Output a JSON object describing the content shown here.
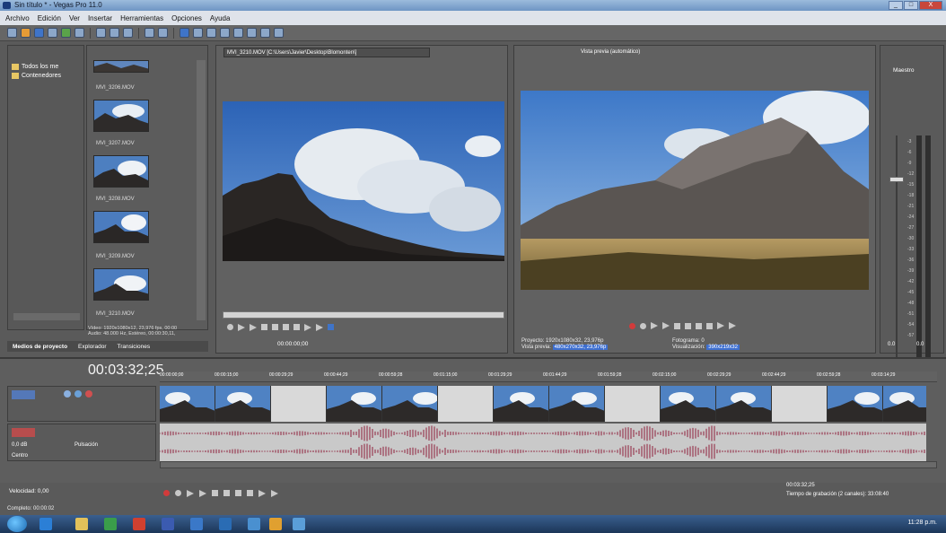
{
  "window": {
    "title": "Sin título * - Vegas Pro 11.0",
    "controls": [
      "_",
      "□",
      "X"
    ]
  },
  "menu": {
    "items": [
      "Archivo",
      "Edición",
      "Ver",
      "Insertar",
      "Herramientas",
      "Opciones",
      "Ayuda"
    ]
  },
  "media_panel": {
    "tree_items": [
      "Todos los me",
      "Contenedores"
    ],
    "thumbnails": [
      "MVI_3206.MOV",
      "MVI_3207.MOV",
      "MVI_3208.MOV",
      "MVI_3209.MOV",
      "MVI_3210.MOV"
    ],
    "info_lines": [
      "Vídeo: 1920x1080x12, 23,976 fps, 00:00",
      "Audio: 48.000 Hz, Estéreo, 00:00:30,11,"
    ],
    "tabs": [
      "Medios de proyecto",
      "Explorador",
      "Transiciones"
    ]
  },
  "trimmer": {
    "path": "MVI_3210.MOV   [C:\\Users\\Javier\\Desktop\\Blomonten\\]",
    "timecode": "00:00:00;00"
  },
  "preview": {
    "quality": "Vista previa (automático)",
    "info": {
      "project_label": "Proyecto:",
      "project_value": "1920x1080x32, 23,976p",
      "preview_label": "Vista previa:",
      "preview_value": "480x270x32, 23,976p",
      "frame_label": "Fotograma:",
      "frame_value": "0",
      "display_label": "Visualización:",
      "display_value": "390x219x32"
    }
  },
  "master": {
    "label": "Maestro",
    "db_ticks": [
      "-3",
      "-6",
      "-9",
      "-12",
      "-15",
      "-18",
      "-21",
      "-24",
      "-27",
      "-30",
      "-33",
      "-36",
      "-39",
      "-42",
      "-45",
      "-48",
      "-51",
      "-54",
      "-57"
    ],
    "bottom_values": [
      "0.0",
      "0.0"
    ]
  },
  "timeline": {
    "current_time": "00:03:32;25",
    "ruler_labels": [
      "00:00:00;00",
      "00:00:15;00",
      "00:00:29;29",
      "00:00:44;29",
      "00:00:59;28",
      "00:01:15;00",
      "00:01:29;29",
      "00:01:44;29",
      "00:01:59;28",
      "00:02:15;00",
      "00:02:29;29",
      "00:02:44;29",
      "00:02:59;28",
      "00:03:14;29"
    ],
    "audio_track": {
      "volume": "0,0 dB",
      "pan": "Centro",
      "mode": "Pulsación"
    },
    "velocity": "Velocidad: 0,00",
    "end_time": "00:03:32;25",
    "rec_time": "Tiempo de grabación (2 canales): 33:08:40"
  },
  "status": {
    "left": "Completo: 00:00:02"
  },
  "taskbar": {
    "clock": "11:28 p.m."
  }
}
